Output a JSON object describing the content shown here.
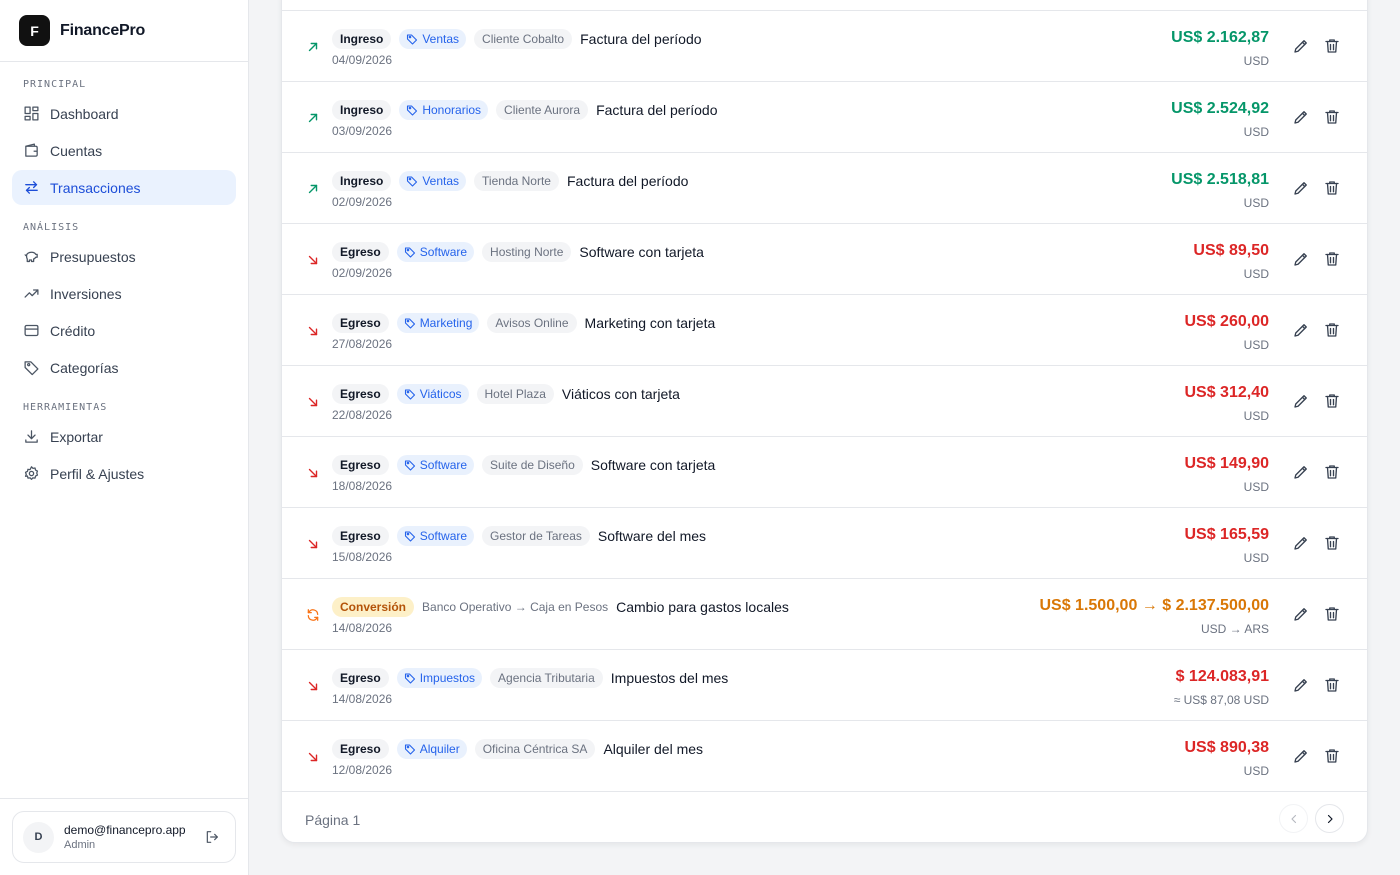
{
  "app": {
    "logo_letter": "F",
    "name": "FinancePro"
  },
  "sidebar": {
    "sections": [
      {
        "label": "PRINCIPAL"
      },
      {
        "label": "ANÁLISIS"
      },
      {
        "label": "HERRAMIENTAS"
      }
    ],
    "items": [
      {
        "label": "Dashboard",
        "icon": "dashboard-icon",
        "active": false
      },
      {
        "label": "Cuentas",
        "icon": "wallet-icon",
        "active": false
      },
      {
        "label": "Transacciones",
        "icon": "arrows-swap-icon",
        "active": true
      },
      {
        "label": "Presupuestos",
        "icon": "piggy-bank-icon",
        "active": false
      },
      {
        "label": "Inversiones",
        "icon": "trending-up-icon",
        "active": false
      },
      {
        "label": "Crédito",
        "icon": "credit-card-icon",
        "active": false
      },
      {
        "label": "Categorías",
        "icon": "tag-icon",
        "active": false
      },
      {
        "label": "Exportar",
        "icon": "download-icon",
        "active": false
      },
      {
        "label": "Perfil & Ajustes",
        "icon": "gear-icon",
        "active": false
      }
    ],
    "user": {
      "initial": "D",
      "email": "demo@financepro.app",
      "role": "Admin"
    }
  },
  "transactions": [
    {
      "kind": "in",
      "type": "Ingreso",
      "category": "Ventas",
      "party": "Cliente Cobalto",
      "description": "Factura del período",
      "date": "04/09/2026",
      "amount": "US$ 2.162,87",
      "currency": "USD"
    },
    {
      "kind": "in",
      "type": "Ingreso",
      "category": "Honorarios",
      "party": "Cliente Aurora",
      "description": "Factura del período",
      "date": "03/09/2026",
      "amount": "US$ 2.524,92",
      "currency": "USD"
    },
    {
      "kind": "in",
      "type": "Ingreso",
      "category": "Ventas",
      "party": "Tienda Norte",
      "description": "Factura del período",
      "date": "02/09/2026",
      "amount": "US$ 2.518,81",
      "currency": "USD"
    },
    {
      "kind": "out",
      "type": "Egreso",
      "category": "Software",
      "party": "Hosting Norte",
      "description": "Software con tarjeta",
      "date": "02/09/2026",
      "amount": "US$ 89,50",
      "currency": "USD"
    },
    {
      "kind": "out",
      "type": "Egreso",
      "category": "Marketing",
      "party": "Avisos Online",
      "description": "Marketing con tarjeta",
      "date": "27/08/2026",
      "amount": "US$ 260,00",
      "currency": "USD"
    },
    {
      "kind": "out",
      "type": "Egreso",
      "category": "Viáticos",
      "party": "Hotel Plaza",
      "description": "Viáticos con tarjeta",
      "date": "22/08/2026",
      "amount": "US$ 312,40",
      "currency": "USD"
    },
    {
      "kind": "out",
      "type": "Egreso",
      "category": "Software",
      "party": "Suite de Diseño",
      "description": "Software con tarjeta",
      "date": "18/08/2026",
      "amount": "US$ 149,90",
      "currency": "USD"
    },
    {
      "kind": "out",
      "type": "Egreso",
      "category": "Software",
      "party": "Gestor de Tareas",
      "description": "Software del mes",
      "date": "15/08/2026",
      "amount": "US$ 165,59",
      "currency": "USD"
    },
    {
      "kind": "conv",
      "type": "Conversión",
      "route": "Banco Operativo → Caja en Pesos",
      "description": "Cambio para gastos locales",
      "date": "14/08/2026",
      "amount": "US$ 1.500,00 → $ 2.137.500,00",
      "currency": "USD → ARS"
    },
    {
      "kind": "out",
      "type": "Egreso",
      "category": "Impuestos",
      "party": "Agencia Tributaria",
      "description": "Impuestos del mes",
      "date": "14/08/2026",
      "amount": "$ 124.083,91",
      "currency": "≈ US$ 87,08 USD"
    },
    {
      "kind": "out",
      "type": "Egreso",
      "category": "Alquiler",
      "party": "Oficina Céntrica SA",
      "description": "Alquiler del mes",
      "date": "12/08/2026",
      "amount": "US$ 890,38",
      "currency": "USD"
    }
  ],
  "pagination": {
    "label": "Página 1"
  },
  "colors": {
    "income": "#059669",
    "expense": "#dc2626",
    "conversion": "#d97706",
    "accent": "#2563eb"
  }
}
